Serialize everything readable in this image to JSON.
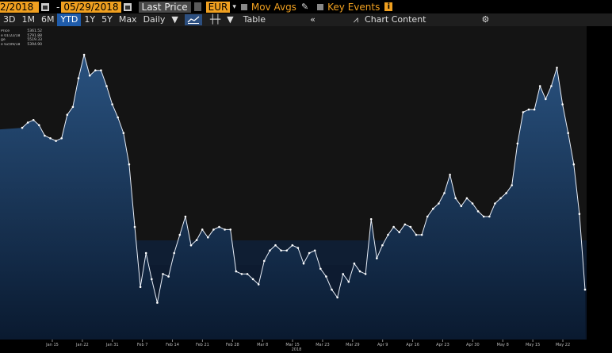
{
  "toolbar": {
    "start_date": "2/2018",
    "end_date": "05/29/2018",
    "dash": "-",
    "field": "Last Price",
    "currency": "EUR",
    "mov_avgs": "Mov Avgs",
    "key_events": "Key Events",
    "info_glyph": "i"
  },
  "periods": [
    "3D",
    "1M",
    "6M",
    "YTD",
    "1Y",
    "5Y",
    "Max"
  ],
  "active_period": "YTD",
  "frequency": "Daily",
  "table_label": "Table",
  "collapse_glyph": "«",
  "chart_content_label": "Chart Content",
  "settings_glyph": "⚙",
  "legend": [
    {
      "label": "Price",
      "value": "5361.52"
    },
    {
      "label": "e 01/22/18",
      "value": "5791.88"
    },
    {
      "label": "ge",
      "value": "5519.33"
    },
    {
      "label": "e 02/09/18",
      "value": "5394.90"
    }
  ],
  "colors": {
    "accent": "#f0a020",
    "active_button": "#1f5cab",
    "series_line": "#e8eef8",
    "fill_top": "#2a5585",
    "fill_bottom": "#0a1a30"
  },
  "chart_data": {
    "type": "area",
    "x_ticks": [
      "Jan 15",
      "Jan 22",
      "Jan 31",
      "Feb 7",
      "Feb 14",
      "Feb 21",
      "Feb 28",
      "Mar 8",
      "Mar 15",
      "Mar 23",
      "Mar 29",
      "Apr 9",
      "Apr 16",
      "Apr 23",
      "Apr 30",
      "May 8",
      "May 15",
      "May 22"
    ],
    "x_year_label": "2018",
    "values": [
      0.72,
      0.74,
      0.75,
      0.73,
      0.69,
      0.68,
      0.67,
      0.68,
      0.77,
      0.8,
      0.91,
      1.0,
      0.92,
      0.94,
      0.94,
      0.88,
      0.81,
      0.76,
      0.7,
      0.58,
      0.34,
      0.11,
      0.24,
      0.14,
      0.05,
      0.16,
      0.15,
      0.24,
      0.31,
      0.38,
      0.27,
      0.29,
      0.33,
      0.3,
      0.33,
      0.34,
      0.33,
      0.33,
      0.17,
      0.16,
      0.16,
      0.14,
      0.12,
      0.21,
      0.25,
      0.27,
      0.25,
      0.25,
      0.27,
      0.26,
      0.2,
      0.24,
      0.25,
      0.18,
      0.15,
      0.1,
      0.07,
      0.16,
      0.13,
      0.2,
      0.17,
      0.16,
      0.37,
      0.22,
      0.27,
      0.31,
      0.34,
      0.32,
      0.35,
      0.34,
      0.31,
      0.31,
      0.38,
      0.41,
      0.43,
      0.47,
      0.54,
      0.45,
      0.42,
      0.45,
      0.43,
      0.4,
      0.38,
      0.38,
      0.43,
      0.45,
      0.47,
      0.5,
      0.66,
      0.78,
      0.79,
      0.79,
      0.88,
      0.83,
      0.88,
      0.95,
      0.81,
      0.7,
      0.58,
      0.39,
      0.1
    ],
    "ylim": [
      0,
      1
    ]
  }
}
